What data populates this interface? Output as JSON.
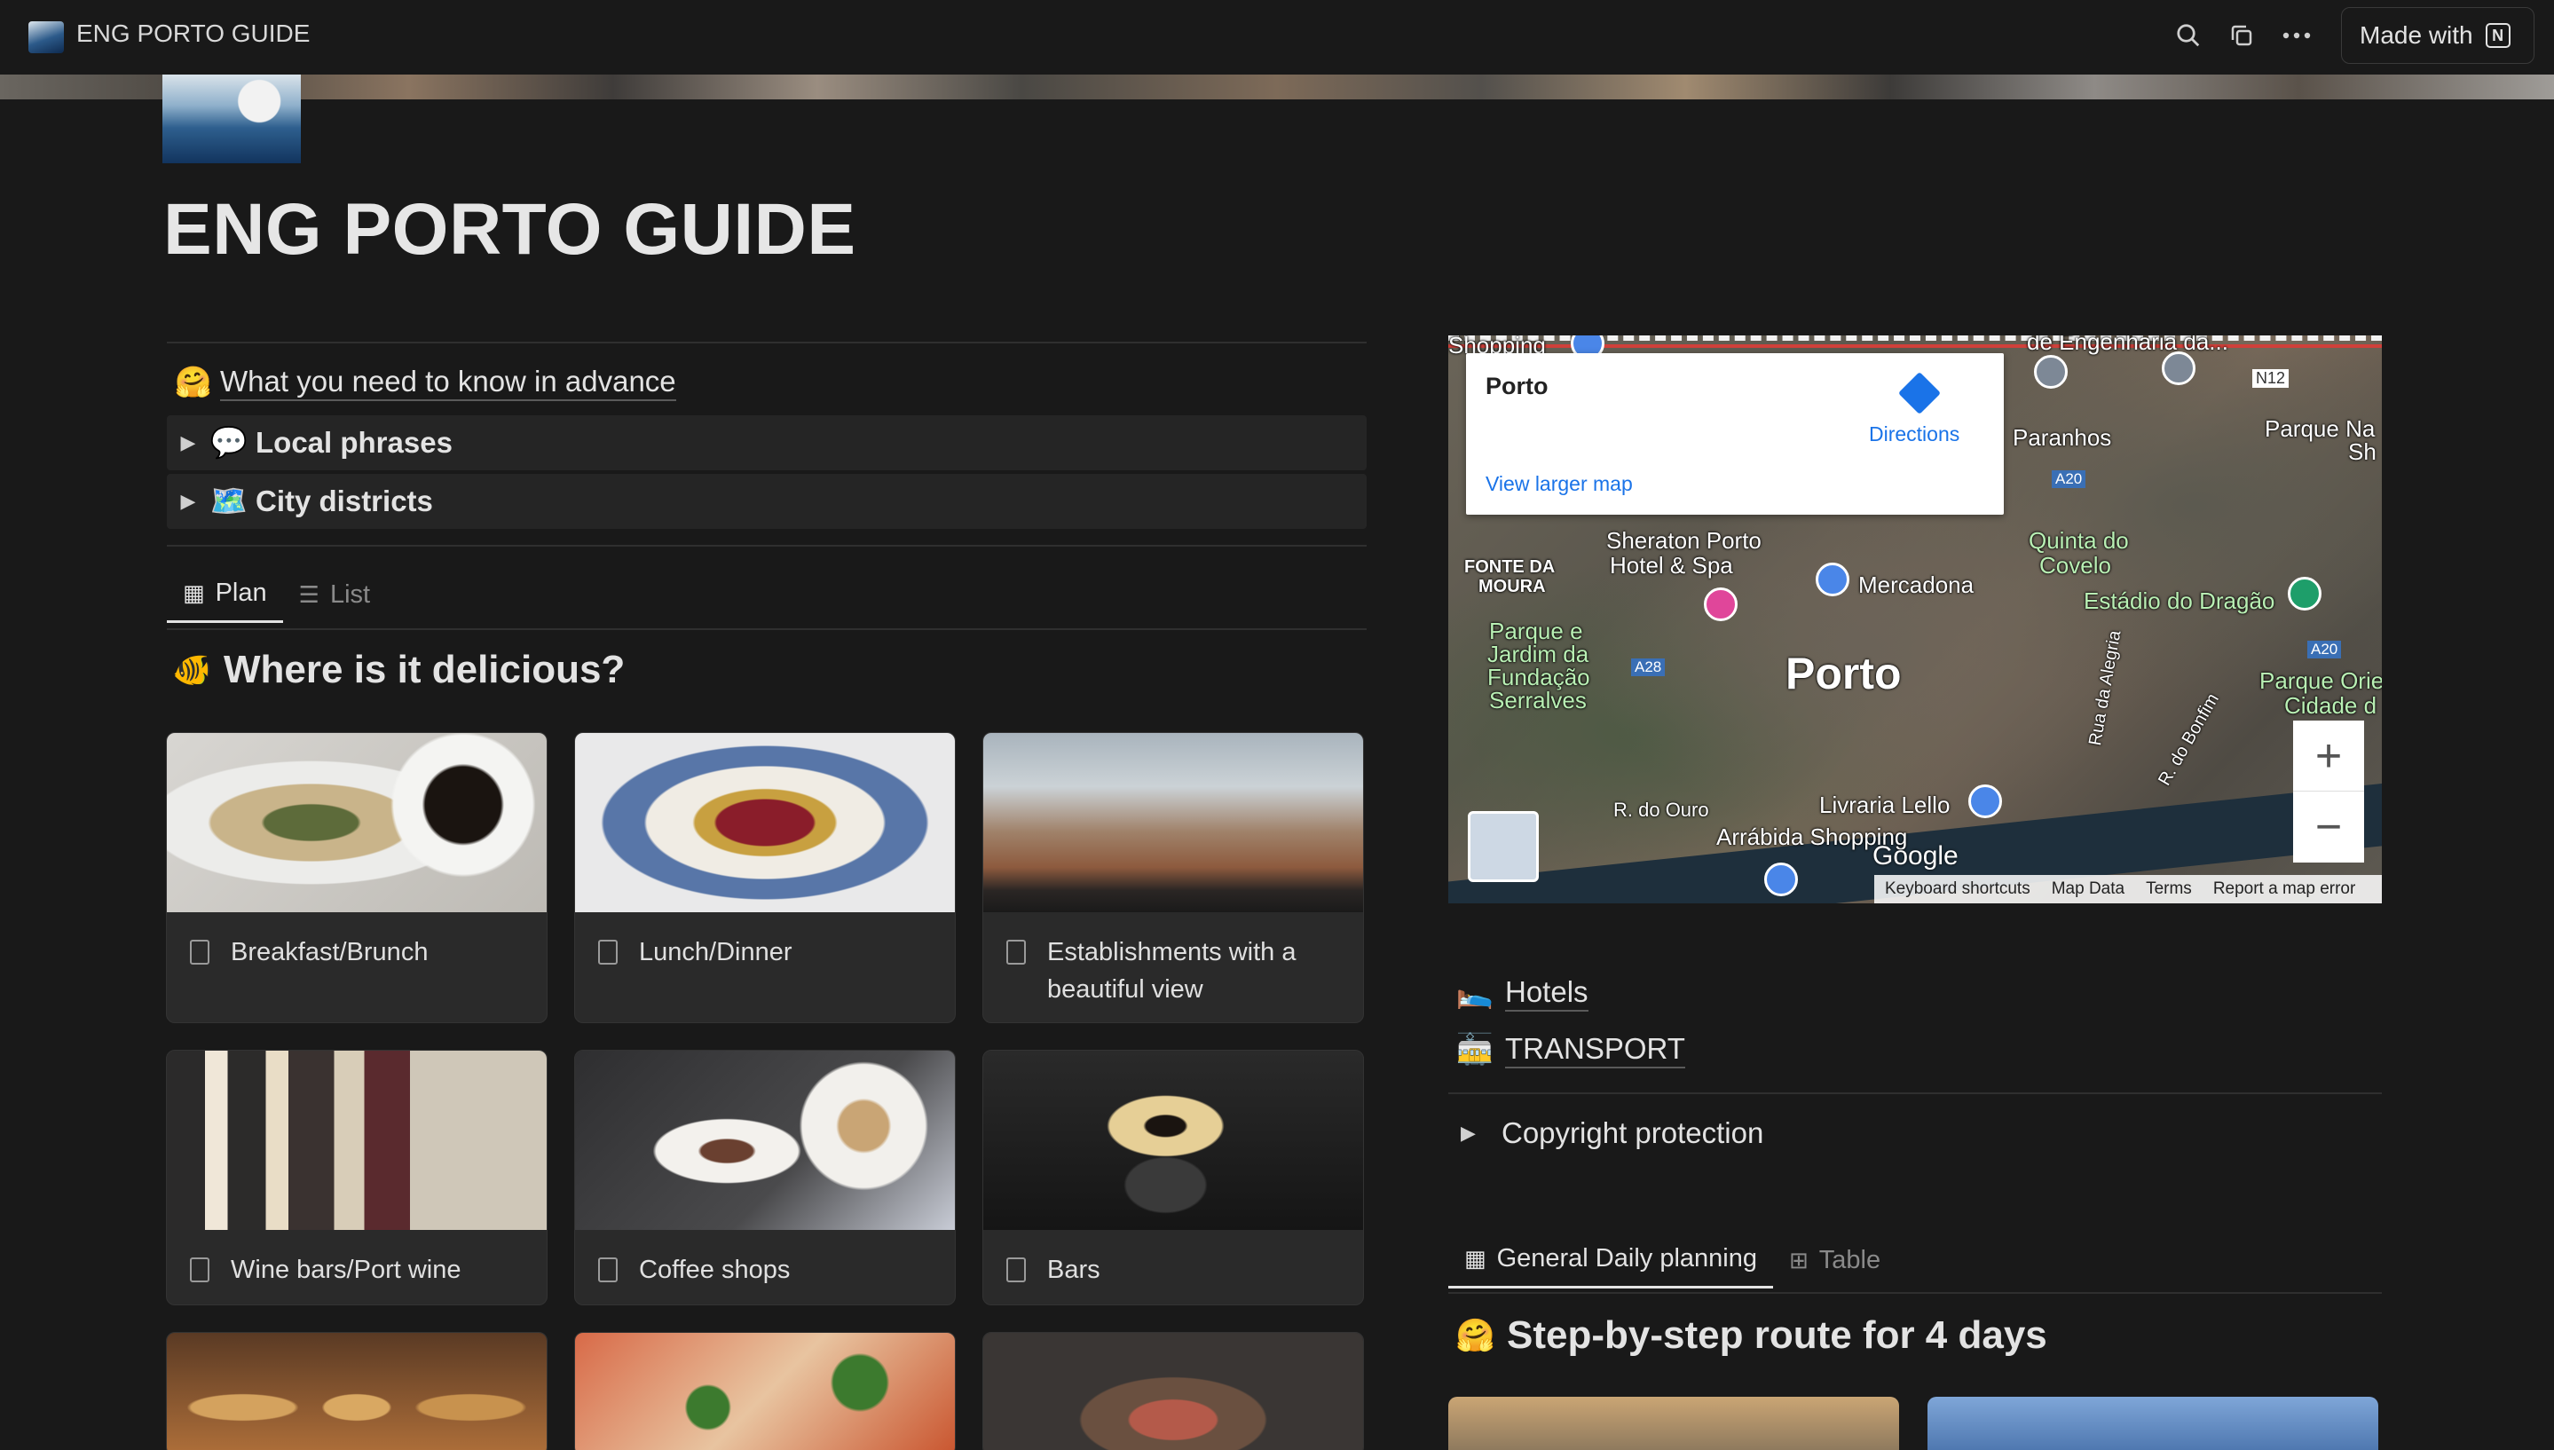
{
  "topbar": {
    "workspace_title": "ENG PORTO GUIDE",
    "made_with_label": "Made with"
  },
  "page": {
    "title": "ENG PORTO GUIDE"
  },
  "left": {
    "know_link": "What you need to know in advance",
    "toggles": [
      {
        "emoji": "💬",
        "label": "Local phrases"
      },
      {
        "emoji": "🗺️",
        "label": "City districts"
      }
    ],
    "tabs": [
      {
        "label": "Plan",
        "active": true
      },
      {
        "label": "List",
        "active": false
      }
    ],
    "section_title": "Where is it delicious?",
    "cards": [
      {
        "label": "Breakfast/Brunch"
      },
      {
        "label": "Lunch/Dinner"
      },
      {
        "label": "Establishments with a beautiful view"
      },
      {
        "label": "Wine bars/Port wine"
      },
      {
        "label": "Coffee shops"
      },
      {
        "label": "Bars"
      }
    ]
  },
  "map": {
    "place": "Porto",
    "directions": "Directions",
    "view_larger": "View larger map",
    "labels": {
      "shopping": "Shopping",
      "engenharia": "de Engenharia da...",
      "n12": "N12",
      "paranhos": "Paranhos",
      "parque_na": "Parque Na",
      "sh": "Sh",
      "a20_top": "A20",
      "sheraton": "Sheraton Porto",
      "hotel_spa": "Hotel & Spa",
      "quinta": "Quinta do",
      "covelo": "Covelo",
      "fonte": "FONTE DA",
      "moura": "MOURA",
      "mercadona": "Mercadona",
      "estadio": "Estádio do Dragão",
      "parque_jardim": "Parque e",
      "jardim_da": "Jardim da",
      "fundacao": "Fundação",
      "serralves": "Serralves",
      "a28": "A28",
      "porto": "Porto",
      "a20_right": "A20",
      "parque_ori": "Parque Orie",
      "cidade": "Cidade d",
      "rua_alegria": "Rua da Alegria",
      "bonfim": "R. do Bonfim",
      "ouro": "R. do Ouro",
      "livraria": "Livraria Lello",
      "arrabida": "Arrábida Shopping",
      "google": "Google"
    },
    "attribution": [
      "Keyboard shortcuts",
      "Map Data",
      "Terms",
      "Report a map error"
    ]
  },
  "right": {
    "links": [
      {
        "emoji": "🛌",
        "label": "Hotels"
      },
      {
        "emoji": "🚋",
        "label": "TRANSPORT"
      }
    ],
    "copyright_toggle": "Copyright protection",
    "tabs": [
      {
        "label": "General Daily planning",
        "active": true
      },
      {
        "label": "Table",
        "active": false
      }
    ],
    "route_title": "Step-by-step route for 4 days"
  },
  "icons": {
    "search": "search-icon",
    "duplicate": "duplicate-icon",
    "more": "more-icon",
    "notion": "notion-logo-icon"
  }
}
